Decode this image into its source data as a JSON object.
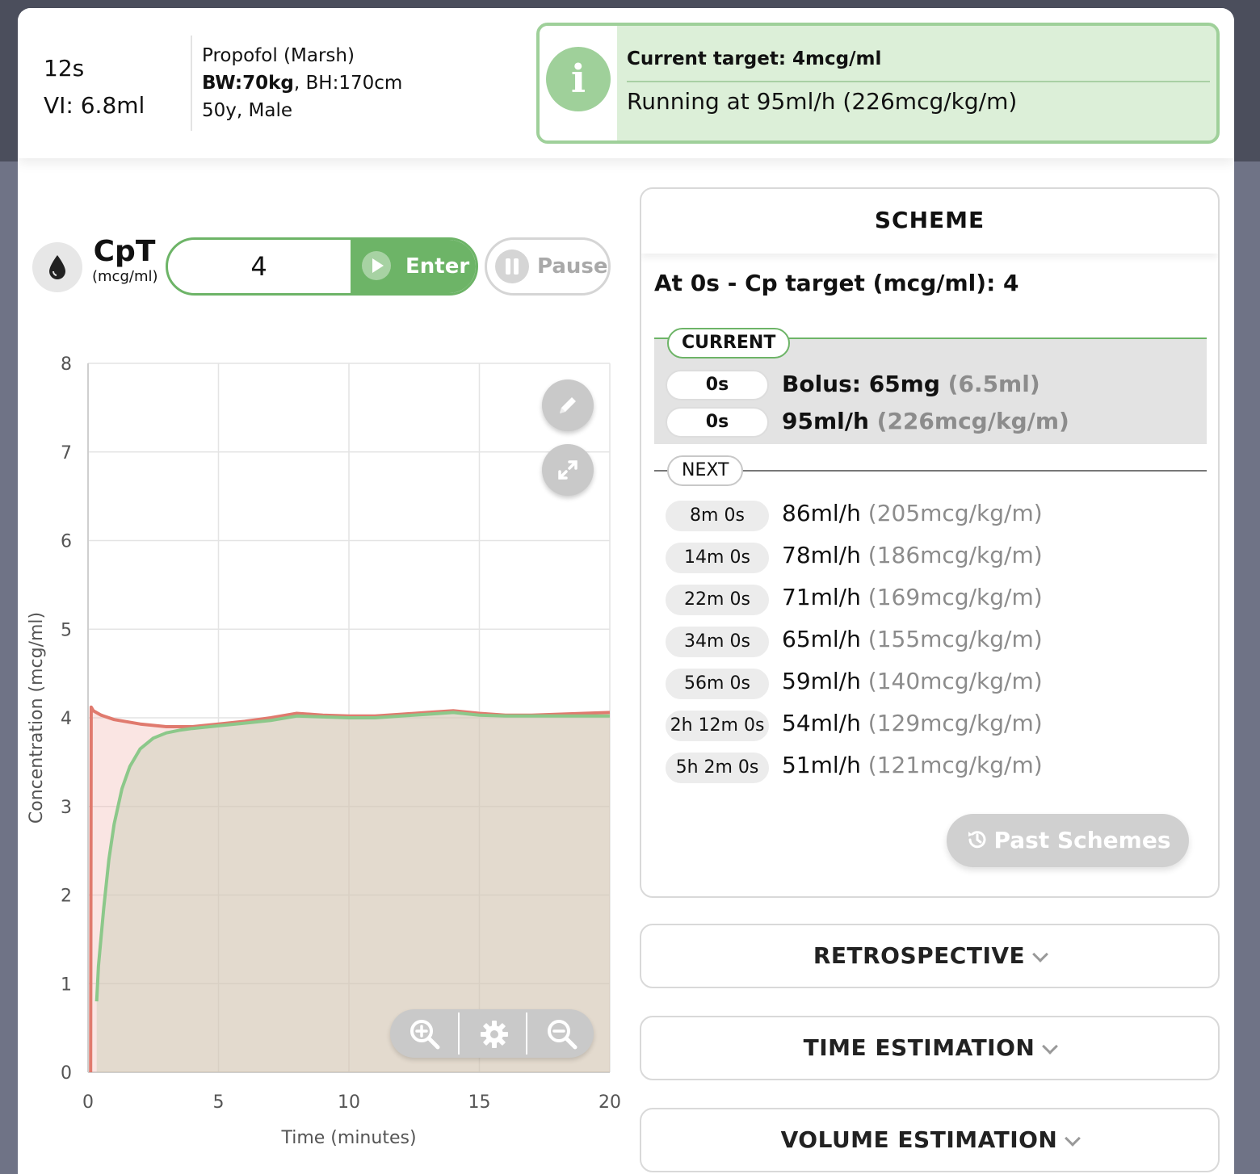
{
  "header": {
    "elapsed": "12s",
    "volume_infused": "VI: 6.8ml",
    "drug_model": "Propofol (Marsh)",
    "body_weight": "BW:70kg",
    "body_height": ", BH:170cm",
    "age_sex": "50y, Male",
    "info": {
      "current_target": "Current target: 4mcg/ml",
      "running": "Running at 95ml/h (226mcg/kg/m)"
    }
  },
  "controls": {
    "mode_label": "CpT",
    "unit_label": "(mcg/ml)",
    "target_value": "4",
    "enter_label": "Enter",
    "pause_label": "Pause"
  },
  "chart_data": {
    "type": "line",
    "xlabel": "Time (minutes)",
    "ylabel": "Concentration (mcg/ml)",
    "xlim": [
      0,
      20
    ],
    "ylim": [
      0,
      8
    ],
    "xticks": [
      "0",
      "5",
      "10",
      "15",
      "20"
    ],
    "yticks": [
      "0",
      "1",
      "2",
      "3",
      "4",
      "5",
      "6",
      "7",
      "8"
    ],
    "grid": true,
    "series": [
      {
        "color": "#e07a6e",
        "x": [
          0.1,
          0.12,
          0.2,
          0.5,
          1,
          2,
          3,
          4,
          5,
          6,
          7,
          8,
          9,
          10,
          11,
          12,
          13,
          14,
          15,
          16,
          17,
          18,
          19,
          20
        ],
        "y": [
          0,
          4.12,
          4.08,
          4.03,
          3.98,
          3.93,
          3.9,
          3.9,
          3.93,
          3.96,
          4.0,
          4.05,
          4.03,
          4.02,
          4.02,
          4.04,
          4.06,
          4.08,
          4.05,
          4.03,
          4.03,
          4.04,
          4.05,
          4.06
        ]
      },
      {
        "color": "#8cc88a",
        "x": [
          0.33,
          0.4,
          0.6,
          0.8,
          1,
          1.3,
          1.6,
          2,
          2.5,
          3,
          3.5,
          4,
          5,
          6,
          7,
          8,
          9,
          10,
          11,
          12,
          13,
          14,
          15,
          16,
          17,
          18,
          19,
          20
        ],
        "y": [
          0.8,
          1.2,
          1.85,
          2.4,
          2.8,
          3.2,
          3.45,
          3.65,
          3.77,
          3.83,
          3.86,
          3.88,
          3.91,
          3.94,
          3.97,
          4.02,
          4.01,
          4.0,
          4.0,
          4.02,
          4.04,
          4.06,
          4.03,
          4.02,
          4.02,
          4.02,
          4.02,
          4.02
        ]
      }
    ]
  },
  "scheme": {
    "title": "SCHEME",
    "subtitle": "At 0s - Cp target (mcg/ml): 4",
    "current_label": "CURRENT",
    "current_rows": [
      {
        "time": "0s",
        "main": "Bolus: 65mg",
        "detail": "(6.5ml)"
      },
      {
        "time": "0s",
        "main": "95ml/h",
        "detail": "(226mcg/kg/m)"
      }
    ],
    "next_label": "NEXT",
    "next_rows": [
      {
        "time": "8m 0s",
        "main": "86ml/h",
        "detail": "(205mcg/kg/m)"
      },
      {
        "time": "14m 0s",
        "main": "78ml/h",
        "detail": "(186mcg/kg/m)"
      },
      {
        "time": "22m 0s",
        "main": "71ml/h",
        "detail": "(169mcg/kg/m)"
      },
      {
        "time": "34m 0s",
        "main": "65ml/h",
        "detail": "(155mcg/kg/m)"
      },
      {
        "time": "56m 0s",
        "main": "59ml/h",
        "detail": "(140mcg/kg/m)"
      },
      {
        "time": "2h 12m 0s",
        "main": "54ml/h",
        "detail": "(129mcg/kg/m)"
      },
      {
        "time": "5h 2m 0s",
        "main": "51ml/h",
        "detail": "(121mcg/kg/m)"
      }
    ],
    "past_schemes_label": "Past Schemes"
  },
  "accordions": {
    "retrospective": "RETROSPECTIVE",
    "time_estimation": "TIME ESTIMATION",
    "volume_estimation": "VOLUME ESTIMATION"
  },
  "colors": {
    "accent_green": "#6db467",
    "info_bg": "#dcefd8",
    "cp_line": "#e07a6e",
    "ce_line": "#8cc88a"
  }
}
